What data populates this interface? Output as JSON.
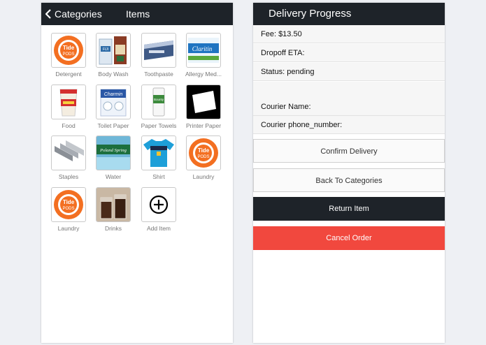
{
  "left_panel": {
    "back_label": "Categories",
    "title": "Items",
    "items": [
      {
        "label": "Detergent",
        "icon": "detergent-pod-icon"
      },
      {
        "label": "Body Wash",
        "icon": "body-wash-icon"
      },
      {
        "label": "Toothpaste",
        "icon": "toothpaste-icon"
      },
      {
        "label": "Allergy Med...",
        "icon": "allergy-medicine-icon"
      },
      {
        "label": "Food",
        "icon": "noodle-cup-icon"
      },
      {
        "label": "Toilet Paper",
        "icon": "toilet-paper-icon"
      },
      {
        "label": "Paper Towels",
        "icon": "paper-towels-icon"
      },
      {
        "label": "Printer Paper",
        "icon": "printer-paper-icon"
      },
      {
        "label": "Staples",
        "icon": "staples-icon"
      },
      {
        "label": "Water",
        "icon": "water-bottles-icon"
      },
      {
        "label": "Shirt",
        "icon": "shirt-icon"
      },
      {
        "label": "Laundry",
        "icon": "detergent-pod-icon"
      },
      {
        "label": "Laundry",
        "icon": "detergent-pod-icon"
      },
      {
        "label": "Drinks",
        "icon": "drinks-icon"
      },
      {
        "label": "Add Item",
        "icon": "plus-circle-icon"
      }
    ],
    "brand_text": {
      "tide": "Tide",
      "pods": "PODS",
      "fiji": "FIJI",
      "claritin": "Claritin",
      "charmin": "Charmin",
      "bounty": "Bounty",
      "poland_spring": "Poland Spring"
    }
  },
  "right_panel": {
    "title": "Delivery Progress",
    "rows": [
      "Fee: $13.50",
      "Dropoff ETA:",
      "Status: pending",
      "",
      "Courier Name:",
      "Courier phone_number:"
    ],
    "buttons": {
      "confirm": "Confirm Delivery",
      "back": "Back To Categories",
      "return": "Return Item",
      "cancel": "Cancel Order"
    }
  },
  "colors": {
    "header_bg": "#1e2329",
    "cancel_red": "#f1483e",
    "tide_orange": "#f36f21"
  }
}
